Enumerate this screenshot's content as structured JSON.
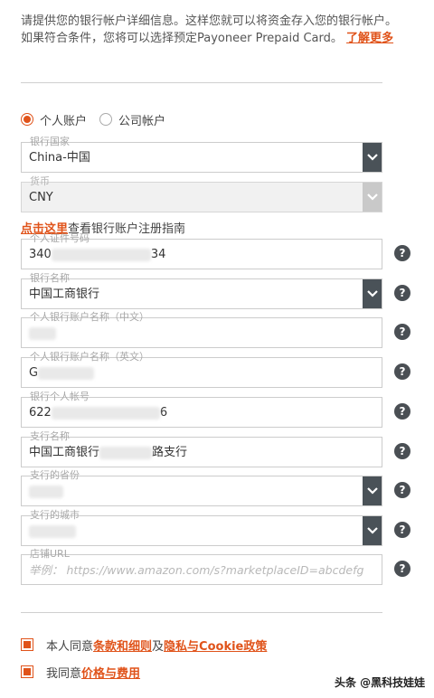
{
  "intro": {
    "text": "请提供您的银行帐户详细信息。这样您就可以将资金存入您的银行帐户。 如果符合条件，您将可以选择预定Payoneer Prepaid Card。",
    "link": "了解更多"
  },
  "account_type": {
    "options": [
      {
        "label": "个人账户",
        "selected": true
      },
      {
        "label": "公司帐户",
        "selected": false
      }
    ]
  },
  "fields": {
    "bank_country": {
      "label": "银行国家",
      "value": "China-中国"
    },
    "currency": {
      "label": "货币",
      "value": "CNY"
    },
    "id_number": {
      "label": "个人证件号码",
      "value_start": "340",
      "value_end": "34"
    },
    "bank_name": {
      "label": "银行名称",
      "value": "中国工商银行"
    },
    "holder_cn": {
      "label": "个人银行账户名称（中文）",
      "value_start": "",
      "value_end": ""
    },
    "holder_en": {
      "label": "个人银行账户名称（英文）",
      "value_start": "G",
      "value_end": ""
    },
    "account_no": {
      "label": "银行个人帐号",
      "value_start": "622",
      "value_end": "6"
    },
    "branch": {
      "label": "支行名称",
      "value_start": "中国工商银行",
      "value_end": "路支行"
    },
    "province": {
      "label": "支行的省份",
      "value": ""
    },
    "city": {
      "label": "支行的城市",
      "value": ""
    },
    "store_url": {
      "label": "店铺URL",
      "placeholder": "举例： https://www.amazon.com/s?marketplaceID=abcdefg"
    }
  },
  "guide": {
    "link": "点击这里",
    "text": "查看银行账户注册指南"
  },
  "help_glyph": "?",
  "agreements": {
    "terms": {
      "prefix": "本人同意",
      "link1": "条款和细则",
      "middle": "及",
      "link2": "隐私与Cookie政策"
    },
    "fees": {
      "prefix": "我同意",
      "link": "价格与费用"
    }
  },
  "watermark": "头条 @黑科技娃娃",
  "colors": {
    "accent": "#e0531a",
    "dropdown": "#4a5258",
    "help": "#4a4f54"
  }
}
